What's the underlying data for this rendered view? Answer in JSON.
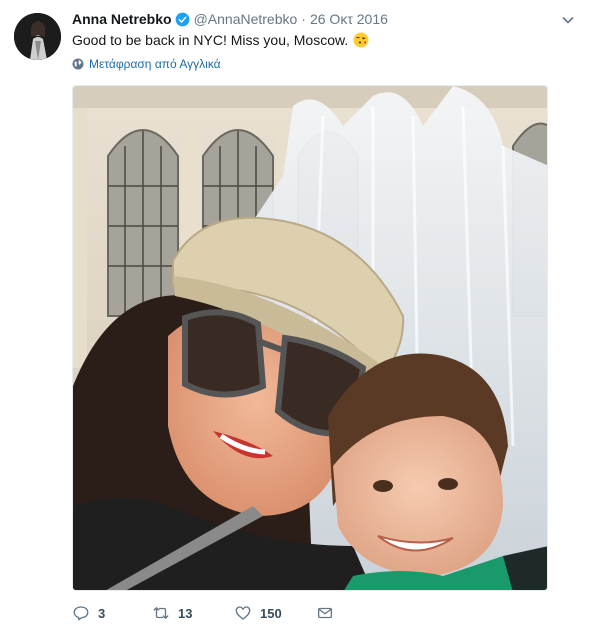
{
  "tweet": {
    "author_name": "Anna Netrebko",
    "handle": "@AnnaNetrebko",
    "separator": "·",
    "timestamp": "26 Οκτ 2016",
    "text": "Good to be back in NYC! Miss you, Moscow.",
    "translate_label": "Μετάφραση από Αγγλικά",
    "media_alt": "Selfie photo",
    "reply_count": "3",
    "retweet_count": "13",
    "like_count": "150"
  },
  "icons": {
    "verified": "verified-badge-icon",
    "caret": "chevron-down-icon",
    "globe": "globe-icon",
    "emoji": "face-blowing-kiss-emoji",
    "reply": "reply-icon",
    "retweet": "retweet-icon",
    "like": "heart-icon",
    "dm": "envelope-icon"
  },
  "colors": {
    "accent": "#1da1f2",
    "link": "#1b6da6",
    "secondary_text": "#657786"
  }
}
